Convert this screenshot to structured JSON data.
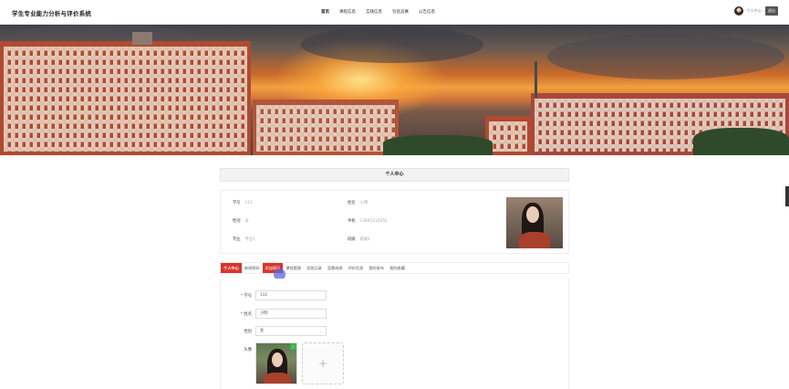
{
  "header": {
    "app_title": "学生专业能力分析与评价系统",
    "nav": [
      "首页",
      "课程信息",
      "实践信息",
      "competitions_label",
      "公告信息"
    ],
    "user_center": "个人中心",
    "logout": "退出"
  },
  "profile": {
    "title": "个人中心",
    "student_id_label": "学号",
    "student_id_value": "111",
    "name_label": "姓名",
    "name_value": "小明",
    "gender_label": "性别",
    "gender_value": "女",
    "phone_label": "手机",
    "phone_value": "13845235652",
    "major_label": "专业",
    "major_value": "专业1",
    "class_label": "班级",
    "class_value": "班级1"
  },
  "tabs": [
    "个人中心",
    "修改密码",
    "添加简历",
    "课程提建",
    "实践记录",
    "竞赛成绩",
    "评价信息",
    "我的发布",
    "我的收藏"
  ],
  "form": {
    "student_id_label": "学号",
    "student_id_value": "111",
    "name_label": "姓名",
    "name_value": "小明",
    "gender_label": "性别",
    "gender_value": "女",
    "avatar_label": "头像",
    "add_symbol": "+",
    "check_symbol": "✓"
  },
  "colors": {
    "accent": "#d9342b",
    "success": "#3cb54a"
  }
}
